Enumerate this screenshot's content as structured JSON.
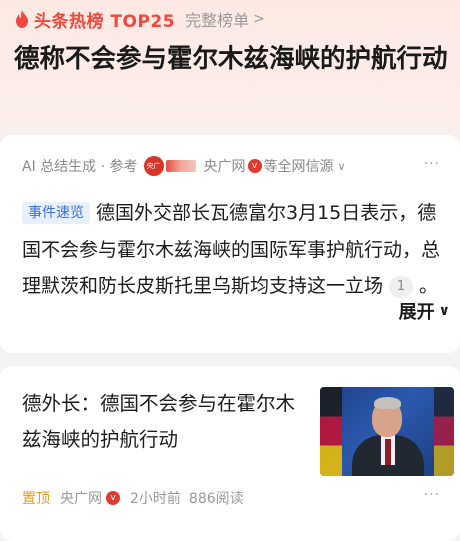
{
  "header": {
    "brand": "头条热榜 TOP25",
    "full_list_label": "完整榜单"
  },
  "headline": "德称不会参与霍尔木兹海峡的护航行动",
  "summary_card": {
    "ai_label": "AI 总结生成 · 参考",
    "source_name": "央广网",
    "source_suffix": "等全网信源",
    "tag": "事件速览",
    "text": "德国外交部长瓦德富尔3月15日表示，德国不会参与霍尔木兹海峡的国际军事护航行动，总理默茨和防长皮斯托里乌斯均支持这一立场",
    "citation": "1",
    "text_end": "。",
    "expand_label": "展开"
  },
  "news_card": {
    "title": "德外长：德国不会参与在霍尔木兹海峡的护航行动",
    "pin_label": "置顶",
    "source": "央广网",
    "time": "2小时前",
    "reads": "886阅读"
  },
  "icons": {
    "flame": "flame-icon",
    "verified": "verified-badge-icon",
    "more": "more-dots-icon"
  },
  "colors": {
    "brand_red": "#f0483e",
    "tag_blue": "#3a6fd8",
    "pin_orange": "#e39a1c"
  }
}
